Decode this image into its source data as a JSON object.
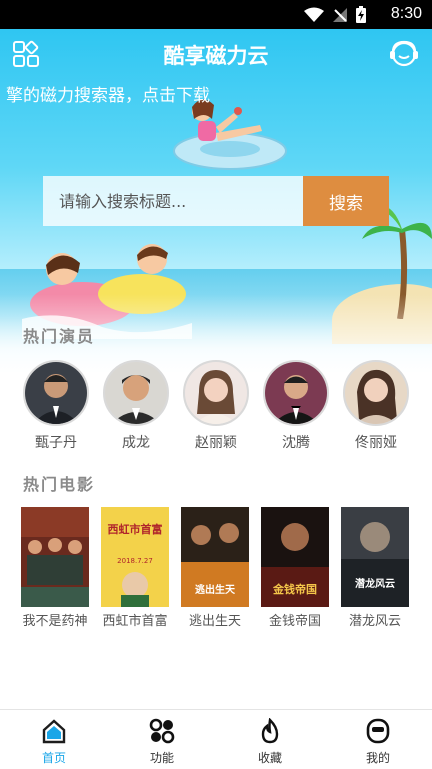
{
  "status_bar": {
    "time": "8:30"
  },
  "header": {
    "title": "酷享磁力云",
    "marquee": "擎的磁力搜索器，点击下载"
  },
  "search": {
    "placeholder": "请输入搜索标题...",
    "button_label": "搜索"
  },
  "sections": {
    "actors_title": "热门演员",
    "movies_title": "热门电影"
  },
  "actors": [
    {
      "name": "甄子丹"
    },
    {
      "name": "成龙"
    },
    {
      "name": "赵丽颖"
    },
    {
      "name": "沈腾"
    },
    {
      "name": "佟丽娅"
    }
  ],
  "movies": [
    {
      "title": "我不是药神"
    },
    {
      "title": "西虹市首富"
    },
    {
      "title": "逃出生天"
    },
    {
      "title": "金钱帝国"
    },
    {
      "title": "潜龙风云"
    }
  ],
  "poster_text": {
    "poster2_title": "西虹市首富",
    "poster2_date": "2018.7.27",
    "poster3_title": "逃出生天",
    "poster4_title": "金钱帝国",
    "poster5_title": "潜龙风云"
  },
  "bottom_nav": [
    {
      "label": "首页",
      "icon": "home-icon",
      "active": true
    },
    {
      "label": "功能",
      "icon": "apps-icon",
      "active": false
    },
    {
      "label": "收藏",
      "icon": "flame-icon",
      "active": false
    },
    {
      "label": "我的",
      "icon": "profile-icon",
      "active": false
    }
  ],
  "colors": {
    "accent": "#1aa6e8",
    "search_button": "#de8d40",
    "hero_top": "#2fc6f2"
  }
}
